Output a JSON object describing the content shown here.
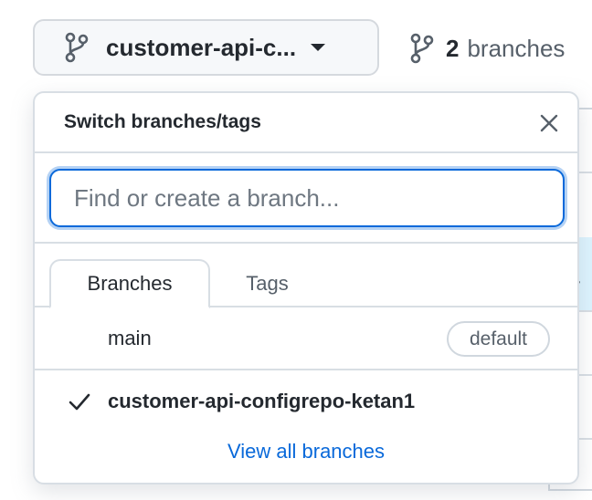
{
  "header": {
    "current_branch_label": "customer-api-c...",
    "branch_count": "2",
    "branch_count_label": "branches"
  },
  "dropdown": {
    "title": "Switch branches/tags",
    "search_placeholder": "Find or create a branch...",
    "tabs": [
      {
        "label": "Branches",
        "active": true
      },
      {
        "label": "Tags",
        "active": false
      }
    ],
    "branches": [
      {
        "name": "main",
        "badge": "default",
        "selected": false
      },
      {
        "name": "customer-api-configrepo-ketan1",
        "badge": "",
        "selected": true
      }
    ],
    "view_all_label": "View all branches"
  },
  "background": {
    "fragment_text": "y"
  },
  "colors": {
    "accent": "#0969da",
    "border": "#d8dee4",
    "muted_text": "#57606a",
    "text": "#24292f"
  },
  "icons": {
    "branch": "git-branch-icon",
    "caret": "triangle-down-icon",
    "close": "x-icon",
    "selected": "check-icon"
  }
}
